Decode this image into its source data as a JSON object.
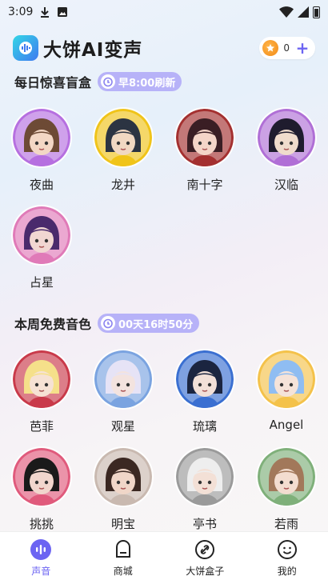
{
  "status_bar": {
    "time": "3:09"
  },
  "header": {
    "app_title": "大饼AI变声",
    "coin_count": "0",
    "plus_icon": "plus-icon",
    "logo_icon": "waveform-logo-icon"
  },
  "daily_box": {
    "title": "每日惊喜盲盒",
    "refresh_label": "早8:00刷新",
    "voices": [
      {
        "name": "夜曲",
        "colors": [
          "#6d4a35",
          "#f3d7c5",
          "#b66fe0"
        ]
      },
      {
        "name": "龙井",
        "colors": [
          "#2c3442",
          "#f1d8c2",
          "#f0c419"
        ]
      },
      {
        "name": "南十字",
        "colors": [
          "#3a1e24",
          "#f4d5c8",
          "#a43030"
        ]
      },
      {
        "name": "汉临",
        "colors": [
          "#1f1c2e",
          "#f0dccc",
          "#b06fd6"
        ]
      },
      {
        "name": "占星",
        "colors": [
          "#4a2a6c",
          "#f1d6d2",
          "#e07ab8"
        ]
      }
    ]
  },
  "weekly_free": {
    "title": "本周免费音色",
    "countdown_label": "00天16时50分",
    "voices": [
      {
        "name": "芭菲",
        "colors": [
          "#f5e08a",
          "#f6e2d4",
          "#c93a4a"
        ]
      },
      {
        "name": "观星",
        "colors": [
          "#e6e3f6",
          "#f3e3df",
          "#7aa3e0"
        ]
      },
      {
        "name": "琉璃",
        "colors": [
          "#1b2540",
          "#f2e0d8",
          "#3a6fd1"
        ]
      },
      {
        "name": "Angel",
        "colors": [
          "#8fbdf2",
          "#f5e3d9",
          "#f4c24a"
        ]
      },
      {
        "name": "挑挑",
        "colors": [
          "#1a1a1a",
          "#f1d6cd",
          "#e05a7c"
        ]
      },
      {
        "name": "明宝",
        "colors": [
          "#3b2822",
          "#f0d6c8",
          "#c9b9b0"
        ]
      },
      {
        "name": "亭书",
        "colors": [
          "#eeeeee",
          "#f3e0d6",
          "#9a9a9a"
        ]
      },
      {
        "name": "若雨",
        "colors": [
          "#a2785a",
          "#f3ddd0",
          "#7fb07a"
        ]
      }
    ]
  },
  "tabbar": {
    "tabs": [
      {
        "label": "声音",
        "icon": "voice-icon"
      },
      {
        "label": "商城",
        "icon": "shop-icon"
      },
      {
        "label": "大饼盒子",
        "icon": "link-box-icon"
      },
      {
        "label": "我的",
        "icon": "profile-smile-icon"
      }
    ]
  },
  "accent_color": "#6c64f2"
}
